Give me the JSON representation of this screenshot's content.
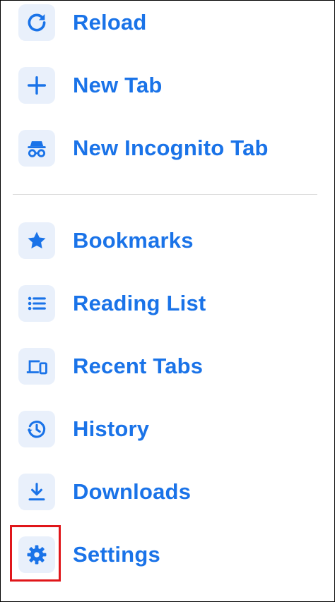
{
  "menu": {
    "items": [
      {
        "id": "reload",
        "label": "Reload",
        "icon": "reload-icon"
      },
      {
        "id": "new-tab",
        "label": "New Tab",
        "icon": "plus-icon"
      },
      {
        "id": "new-incognito-tab",
        "label": "New Incognito Tab",
        "icon": "incognito-icon"
      },
      {
        "id": "bookmarks",
        "label": "Bookmarks",
        "icon": "star-icon"
      },
      {
        "id": "reading-list",
        "label": "Reading List",
        "icon": "list-icon"
      },
      {
        "id": "recent-tabs",
        "label": "Recent Tabs",
        "icon": "devices-icon"
      },
      {
        "id": "history",
        "label": "History",
        "icon": "history-icon"
      },
      {
        "id": "downloads",
        "label": "Downloads",
        "icon": "download-icon"
      },
      {
        "id": "settings",
        "label": "Settings",
        "icon": "gear-icon"
      }
    ]
  },
  "colors": {
    "accent": "#1a73e8",
    "icon_background": "#e9f0fb",
    "divider": "#dcdcdc",
    "highlight_border": "#e0161a"
  }
}
